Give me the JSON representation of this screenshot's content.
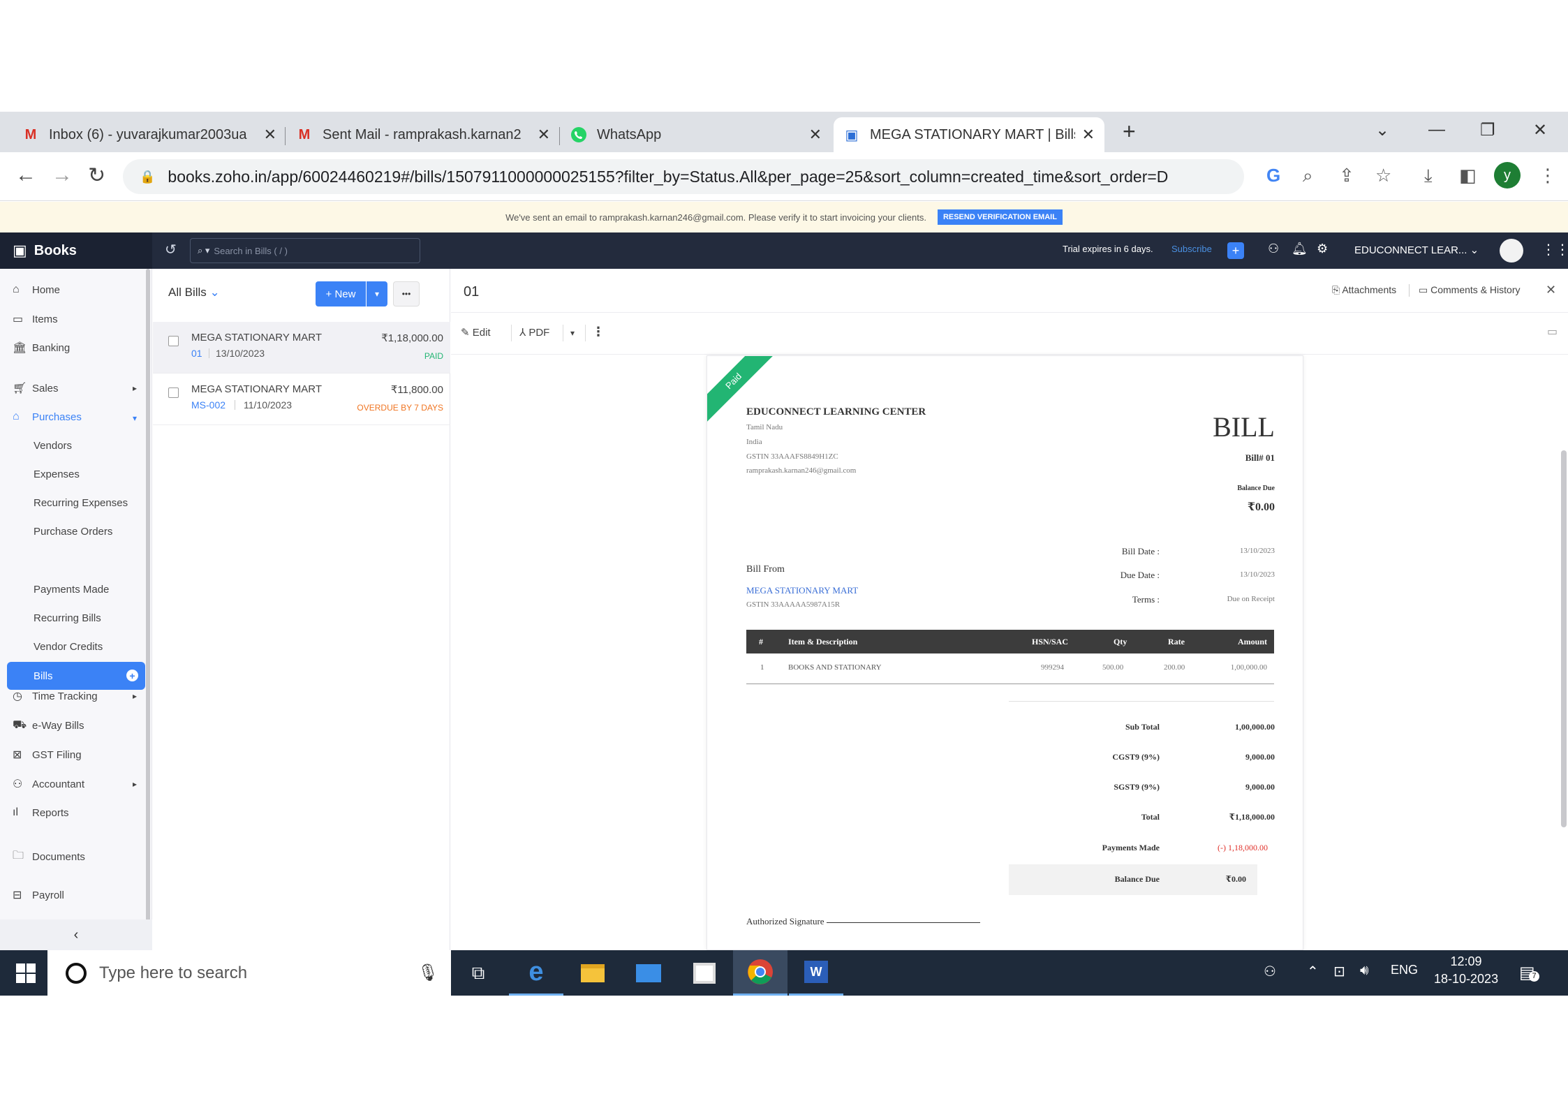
{
  "browser": {
    "tabs": [
      {
        "label": "Inbox (6) - yuvarajkumar2003ua",
        "icon": "M"
      },
      {
        "label": "Sent Mail - ramprakash.karnan2",
        "icon": "M"
      },
      {
        "label": "WhatsApp",
        "icon": "whatsapp-icon"
      },
      {
        "label": "MEGA STATIONARY MART | Bills",
        "icon": "books-icon"
      }
    ],
    "new_tab": "+",
    "url": "books.zoho.in/app/60024460219#/bills/1507911000000025155?filter_by=Status.All&per_page=25&sort_column=created_time&sort_order=D",
    "profile_initial": "y"
  },
  "banner": {
    "text": "We've sent an email to ramprakash.karnan246@gmail.com. Please verify it to start invoicing your clients.",
    "button": "RESEND VERIFICATION EMAIL"
  },
  "header": {
    "brand": "Books",
    "search_placeholder": "Search in Bills ( / )",
    "trial": "Trial expires in 6 days.",
    "subscribe": "Subscribe",
    "org": "EDUCONNECT LEAR...",
    "colors": {
      "header_bg": "#232b3d",
      "accent": "#3b82f6"
    }
  },
  "sidebar": {
    "items": {
      "home": "Home",
      "items": "Items",
      "banking": "Banking",
      "sales": "Sales",
      "purchases": "Purchases",
      "time_tracking": "Time Tracking",
      "eway": "e-Way Bills",
      "gst": "GST Filing",
      "accountant": "Accountant",
      "reports": "Reports",
      "documents": "Documents",
      "payroll": "Payroll"
    },
    "purchases_sub": {
      "vendors": "Vendors",
      "expenses": "Expenses",
      "recurring_expenses": "Recurring Expenses",
      "purchase_orders": "Purchase Orders",
      "bills": "Bills",
      "payments_made": "Payments Made",
      "recurring_bills": "Recurring Bills",
      "vendor_credits": "Vendor Credits"
    }
  },
  "list": {
    "filter": "All Bills",
    "new_button": "+ New",
    "more": "•••",
    "bills": [
      {
        "vendor": "MEGA STATIONARY MART",
        "amount": "₹1,18,000.00",
        "number": "01",
        "date": "13/10/2023",
        "status": "PAID",
        "status_color": "#22b573"
      },
      {
        "vendor": "MEGA STATIONARY MART",
        "amount": "₹11,800.00",
        "number": "MS-002",
        "date": "11/10/2023",
        "status": "OVERDUE BY 7 DAYS",
        "status_color": "#f07522"
      }
    ]
  },
  "detail": {
    "title": "01",
    "attachments": "Attachments",
    "comments": "Comments & History",
    "edit": "Edit",
    "pdf": "PDF"
  },
  "bill": {
    "ribbon": "Paid",
    "company": "EDUCONNECT LEARNING CENTER",
    "state": "Tamil Nadu",
    "country": "India",
    "gstin": "GSTIN 33AAAFS8849H1ZC",
    "email": "ramprakash.karnan246@gmail.com",
    "heading": "BILL",
    "bill_no": "Bill# 01",
    "balance_due_label": "Balance Due",
    "balance_due": "₹0.00",
    "bill_date_label": "Bill Date :",
    "bill_date": "13/10/2023",
    "due_date_label": "Due Date :",
    "due_date": "13/10/2023",
    "terms_label": "Terms :",
    "terms": "Due on Receipt",
    "bill_from_label": "Bill From",
    "vendor": "MEGA STATIONARY MART",
    "vendor_gstin": "GSTIN 33AAAAA5987A15R",
    "table_headers": [
      "#",
      "Item & Description",
      "HSN/SAC",
      "Qty",
      "Rate",
      "Amount"
    ],
    "rows": [
      {
        "idx": "1",
        "desc": "BOOKS AND STATIONARY",
        "hsn": "999294",
        "qty": "500.00",
        "rate": "200.00",
        "amount": "1,00,000.00"
      }
    ],
    "totals": {
      "sub_total_label": "Sub Total",
      "sub_total": "1,00,000.00",
      "cgst_label": "CGST9 (9%)",
      "cgst": "9,000.00",
      "sgst_label": "SGST9 (9%)",
      "sgst": "9,000.00",
      "total_label": "Total",
      "total": "₹1,18,000.00",
      "payments_label": "Payments Made",
      "payments": "(-) 1,18,000.00",
      "balance_label": "Balance Due",
      "balance": "₹0.00"
    },
    "signature": "Authorized Signature"
  },
  "taskbar": {
    "search": "Type here to search",
    "lang": "ENG",
    "time": "12:09",
    "date": "18-10-2023",
    "notif_count": "7"
  }
}
